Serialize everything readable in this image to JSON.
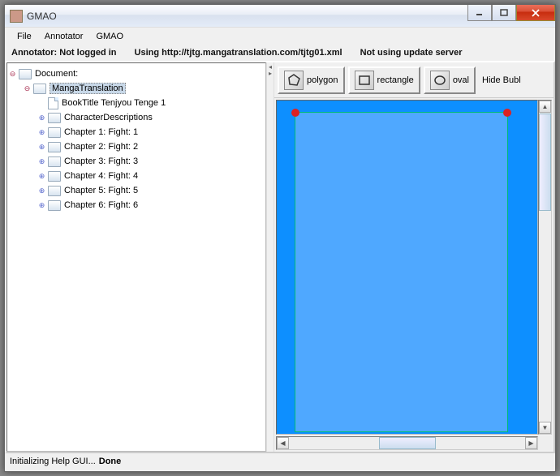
{
  "window": {
    "title": "GMAO"
  },
  "menu": {
    "file": "File",
    "annotator": "Annotator",
    "gmao": "GMAO"
  },
  "status": {
    "login": "Annotator: Not logged in",
    "using": "Using http://tjtg.mangatranslation.com/tjtg01.xml",
    "update": "Not using update server"
  },
  "tree": {
    "root": "Document:",
    "items": [
      {
        "label": "MangaTranslation",
        "selected": true,
        "expandable": true,
        "expanded": true,
        "indent": 1
      },
      {
        "label": "BookTitle Tenjyou Tenge 1",
        "type": "file",
        "indent": 2
      },
      {
        "label": "CharacterDescriptions",
        "expandable": true,
        "indent": 2
      },
      {
        "label": "Chapter 1:  Fight: 1",
        "expandable": true,
        "indent": 2
      },
      {
        "label": "Chapter 2:  Fight: 2",
        "expandable": true,
        "indent": 2
      },
      {
        "label": "Chapter 3:  Fight: 3",
        "expandable": true,
        "indent": 2
      },
      {
        "label": "Chapter 4:  Fight: 4",
        "expandable": true,
        "indent": 2
      },
      {
        "label": "Chapter 5:  Fight: 5",
        "expandable": true,
        "indent": 2
      },
      {
        "label": "Chapter 6:  Fight: 6",
        "expandable": true,
        "indent": 2
      }
    ]
  },
  "toolbar": {
    "polygon": "polygon",
    "rectangle": "rectangle",
    "oval": "oval",
    "hide": "Hide Bubl"
  },
  "footer": {
    "text": "Initializing Help GUI...",
    "done": "Done"
  }
}
